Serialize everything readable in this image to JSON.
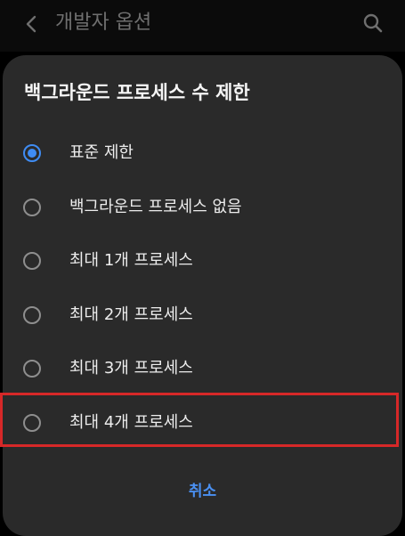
{
  "topbar": {
    "title": "개발자 옵션",
    "back_icon": "chevron-left-icon",
    "search_icon": "search-icon"
  },
  "dialog": {
    "title": "백그라운드 프로세스 수 제한",
    "options": [
      {
        "label": "표준 제한",
        "selected": true
      },
      {
        "label": "백그라운드 프로세스 없음",
        "selected": false
      },
      {
        "label": "최대 1개 프로세스",
        "selected": false
      },
      {
        "label": "최대 2개 프로세스",
        "selected": false
      },
      {
        "label": "최대 3개 프로세스",
        "selected": false
      },
      {
        "label": "최대 4개 프로세스",
        "selected": false
      }
    ],
    "cancel_label": "취소"
  },
  "colors": {
    "accent": "#3f8cf3",
    "highlight_box": "#d62828",
    "dialog_background": "#2a2a2a"
  }
}
